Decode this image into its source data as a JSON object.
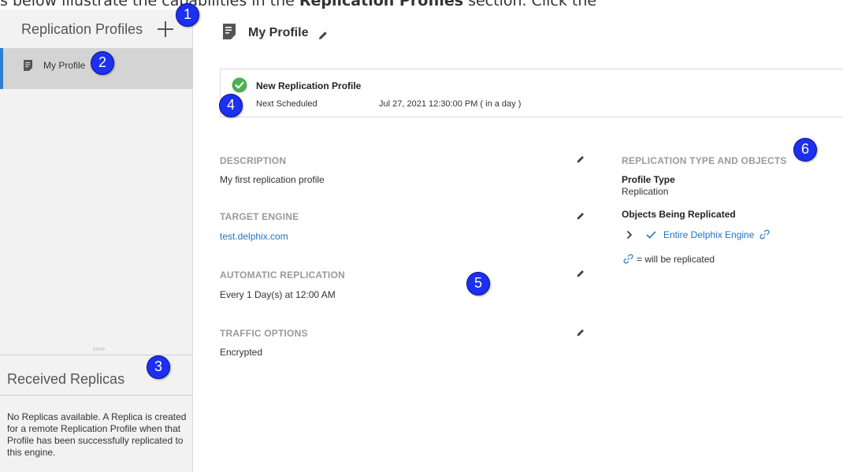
{
  "caption": {
    "prefix": "s below illustrate the capabilities in the ",
    "bold": "Replication Profiles",
    "suffix": " section. Click the"
  },
  "sidebar": {
    "title": "Replication Profiles",
    "add_icon": "plus-icon",
    "profiles": [
      {
        "label": "My Profile",
        "icon": "document-icon",
        "selected": true
      }
    ]
  },
  "received": {
    "title": "Received Replicas",
    "empty_text": "No Replicas available. A Replica is created for a remote Replication Profile when that Profile has been successfully replicated to this engine."
  },
  "main": {
    "title": "My Profile",
    "status": {
      "name": "New Replication Profile",
      "next_label": "Next Scheduled",
      "next_value": "Jul 27, 2021 12:30:00 PM ( in a day )"
    },
    "sections": {
      "description": {
        "heading": "DESCRIPTION",
        "value": "My first replication profile"
      },
      "target": {
        "heading": "TARGET ENGINE",
        "value": "test.delphix.com"
      },
      "automatic": {
        "heading": "AUTOMATIC REPLICATION",
        "value": "Every 1 Day(s) at 12:00 AM"
      },
      "traffic": {
        "heading": "TRAFFIC OPTIONS",
        "value": "Encrypted"
      }
    },
    "replication": {
      "heading": "REPLICATION TYPE AND OBJECTS",
      "profile_type_label": "Profile Type",
      "profile_type_value": "Replication",
      "objects_label": "Objects Being Replicated",
      "object_name": "Entire Delphix Engine",
      "legend": "= will be replicated"
    }
  },
  "callouts": [
    "1",
    "2",
    "3",
    "4",
    "5",
    "6"
  ],
  "colors": {
    "accent": "#2a7fd0",
    "link": "#1e74c8",
    "success": "#4caf50",
    "callout": "#1d2ff0"
  }
}
